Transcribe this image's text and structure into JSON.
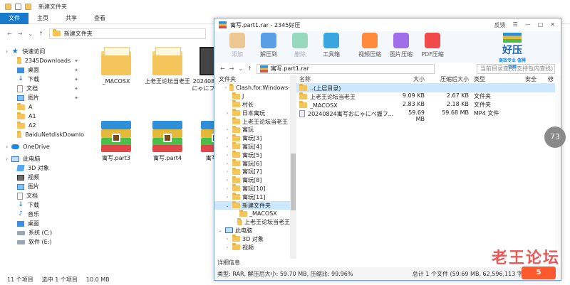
{
  "explorer": {
    "title": "新建文件夹",
    "tabs": [
      "文件",
      "主页",
      "共享",
      "查看"
    ],
    "address": "新建文件夹",
    "nav": [
      {
        "label": "快速访问",
        "type": "header",
        "icon": "star-icon"
      },
      {
        "label": "2345Downloads",
        "pin": true,
        "icon": "folder-icon"
      },
      {
        "label": "桌面",
        "pin": true,
        "icon": "desktop-icon"
      },
      {
        "label": "下载",
        "pin": true,
        "icon": "download-icon"
      },
      {
        "label": "文档",
        "pin": true,
        "icon": "document-icon"
      },
      {
        "label": "图片",
        "pin": true,
        "icon": "picture-icon"
      },
      {
        "label": "A",
        "icon": "folder-icon"
      },
      {
        "label": "A1",
        "icon": "folder-icon"
      },
      {
        "label": "A2",
        "icon": "folder-icon"
      },
      {
        "label": "BaiduNetdiskDownlo",
        "icon": "folder-icon"
      },
      {
        "label": "OneDrive",
        "type": "header",
        "icon": "cloud-icon"
      },
      {
        "label": "此电脑",
        "type": "header",
        "icon": "computer-icon"
      },
      {
        "label": "3D 对象",
        "icon": "3d-object-icon"
      },
      {
        "label": "视频",
        "icon": "video-icon"
      },
      {
        "label": "图片",
        "icon": "picture-icon"
      },
      {
        "label": "文档",
        "icon": "document-icon"
      },
      {
        "label": "下载",
        "icon": "download-icon"
      },
      {
        "label": "音乐",
        "icon": "music-icon"
      },
      {
        "label": "桌面",
        "icon": "desktop-icon"
      },
      {
        "label": "系统 (C:)",
        "icon": "drive-icon"
      },
      {
        "label": "软件 (E:)",
        "icon": "drive-icon"
      }
    ],
    "files": [
      {
        "name": "_MACOSX",
        "kind": "folder"
      },
      {
        "name": "上老王论坛当老王",
        "kind": "folder"
      },
      {
        "name": "20240824寓写おにゃにフリデ(ナニ",
        "kind": "video"
      },
      {
        "name": "寓写.part3",
        "kind": "rar"
      },
      {
        "name": "寓写.part4",
        "kind": "rar"
      },
      {
        "name": "寓写.pa",
        "kind": "rar"
      }
    ],
    "status": {
      "count": "11 个项目",
      "selected": "选中 1 个项目",
      "size": "10.0 MB"
    }
  },
  "rar": {
    "title": "寓写.part1.rar - 2345好压",
    "title_right": [
      "反馈",
      "☰",
      "—",
      "□",
      "✕"
    ],
    "tools": [
      {
        "label": "添加",
        "dim": true,
        "color": "#e8a040"
      },
      {
        "label": "解压到",
        "dim": false,
        "color": "#5a9ee8"
      },
      {
        "label": "删除",
        "dim": true,
        "color": "#4cc08a"
      },
      {
        "label": "工具箱",
        "dim": false,
        "color": "#3aa6e0"
      },
      {
        "label": "视频压缩",
        "dim": false,
        "color": "#ff8a3c"
      },
      {
        "label": "图片压缩",
        "dim": false,
        "color": "#a06ee8"
      },
      {
        "label": "PDF压缩",
        "dim": false,
        "color": "#f04a4a"
      }
    ],
    "logo": {
      "name": "好压",
      "tagline": "高效专业 值得信赖"
    },
    "path": "寓写.part1.rar",
    "search_placeholder": "当前目录查找(支持包内查找)",
    "tree_header": "文件夹",
    "tree": [
      {
        "label": "Clash.for.Windows-",
        "lvl": 1,
        "arrow": "›"
      },
      {
        "label": "J",
        "lvl": 1,
        "arrow": ""
      },
      {
        "label": "村长",
        "lvl": 1,
        "arrow": ""
      },
      {
        "label": "日本寓玩",
        "lvl": 1,
        "arrow": "›"
      },
      {
        "label": "上老王论坛当老王",
        "lvl": 1,
        "arrow": ""
      },
      {
        "label": "寓玩",
        "lvl": 1,
        "arrow": "›"
      },
      {
        "label": "寓玩[3]",
        "lvl": 1,
        "arrow": "›"
      },
      {
        "label": "寓玩[4]",
        "lvl": 1,
        "arrow": "›"
      },
      {
        "label": "寓玩[5]",
        "lvl": 1,
        "arrow": "›"
      },
      {
        "label": "寓玩[6]",
        "lvl": 1,
        "arrow": "›"
      },
      {
        "label": "寓玩[7]",
        "lvl": 1,
        "arrow": "›"
      },
      {
        "label": "寓玩[8]",
        "lvl": 1,
        "arrow": "›"
      },
      {
        "label": "寓玩[10]",
        "lvl": 1,
        "arrow": "›"
      },
      {
        "label": "寓玩[11]",
        "lvl": 1,
        "arrow": "›"
      },
      {
        "label": "新建文件夹",
        "lvl": 1,
        "arrow": "⌄",
        "sel": true
      },
      {
        "label": "_MACOSX",
        "lvl": 2,
        "arrow": ""
      },
      {
        "label": "上老王论坛当老王",
        "lvl": 2,
        "arrow": ""
      },
      {
        "label": "此电脑",
        "lvl": 0,
        "arrow": "⌄",
        "pc": true
      },
      {
        "label": "3D 对象",
        "lvl": 1,
        "arrow": "›"
      },
      {
        "label": "视频",
        "lvl": 1,
        "arrow": "›"
      }
    ],
    "columns": [
      "名称",
      "大小",
      "压缩后大小",
      "类型",
      "安全",
      "修"
    ],
    "rows": [
      {
        "name": "..(上层目录)",
        "size": "",
        "packed": "",
        "type": "",
        "sel": true,
        "icon": "folder"
      },
      {
        "name": "上老王论坛当老王",
        "size": "9.09 KB",
        "packed": "2.67 KB",
        "type": "文件夹",
        "icon": "folder"
      },
      {
        "name": "_MACOSX",
        "size": "2.83 KB",
        "packed": "2.18 KB",
        "type": "文件夹",
        "icon": "folder"
      },
      {
        "name": "20240824寓写おにゃにペ握フ...",
        "size": "59.69 MB",
        "packed": "59.68 MB",
        "type": "MP4 文件",
        "icon": "mp4"
      }
    ],
    "detail_label": "详细信息",
    "status_left": "类型: RAR, 解压后大小: 59.70 MB, 压缩比: 99.96%",
    "status_right": "总计 1 个文件 (59.69 MB, 62,596,113 字节)"
  },
  "overlay": {
    "badge": "73",
    "watermark": "老王论坛",
    "watermark2": "5"
  }
}
